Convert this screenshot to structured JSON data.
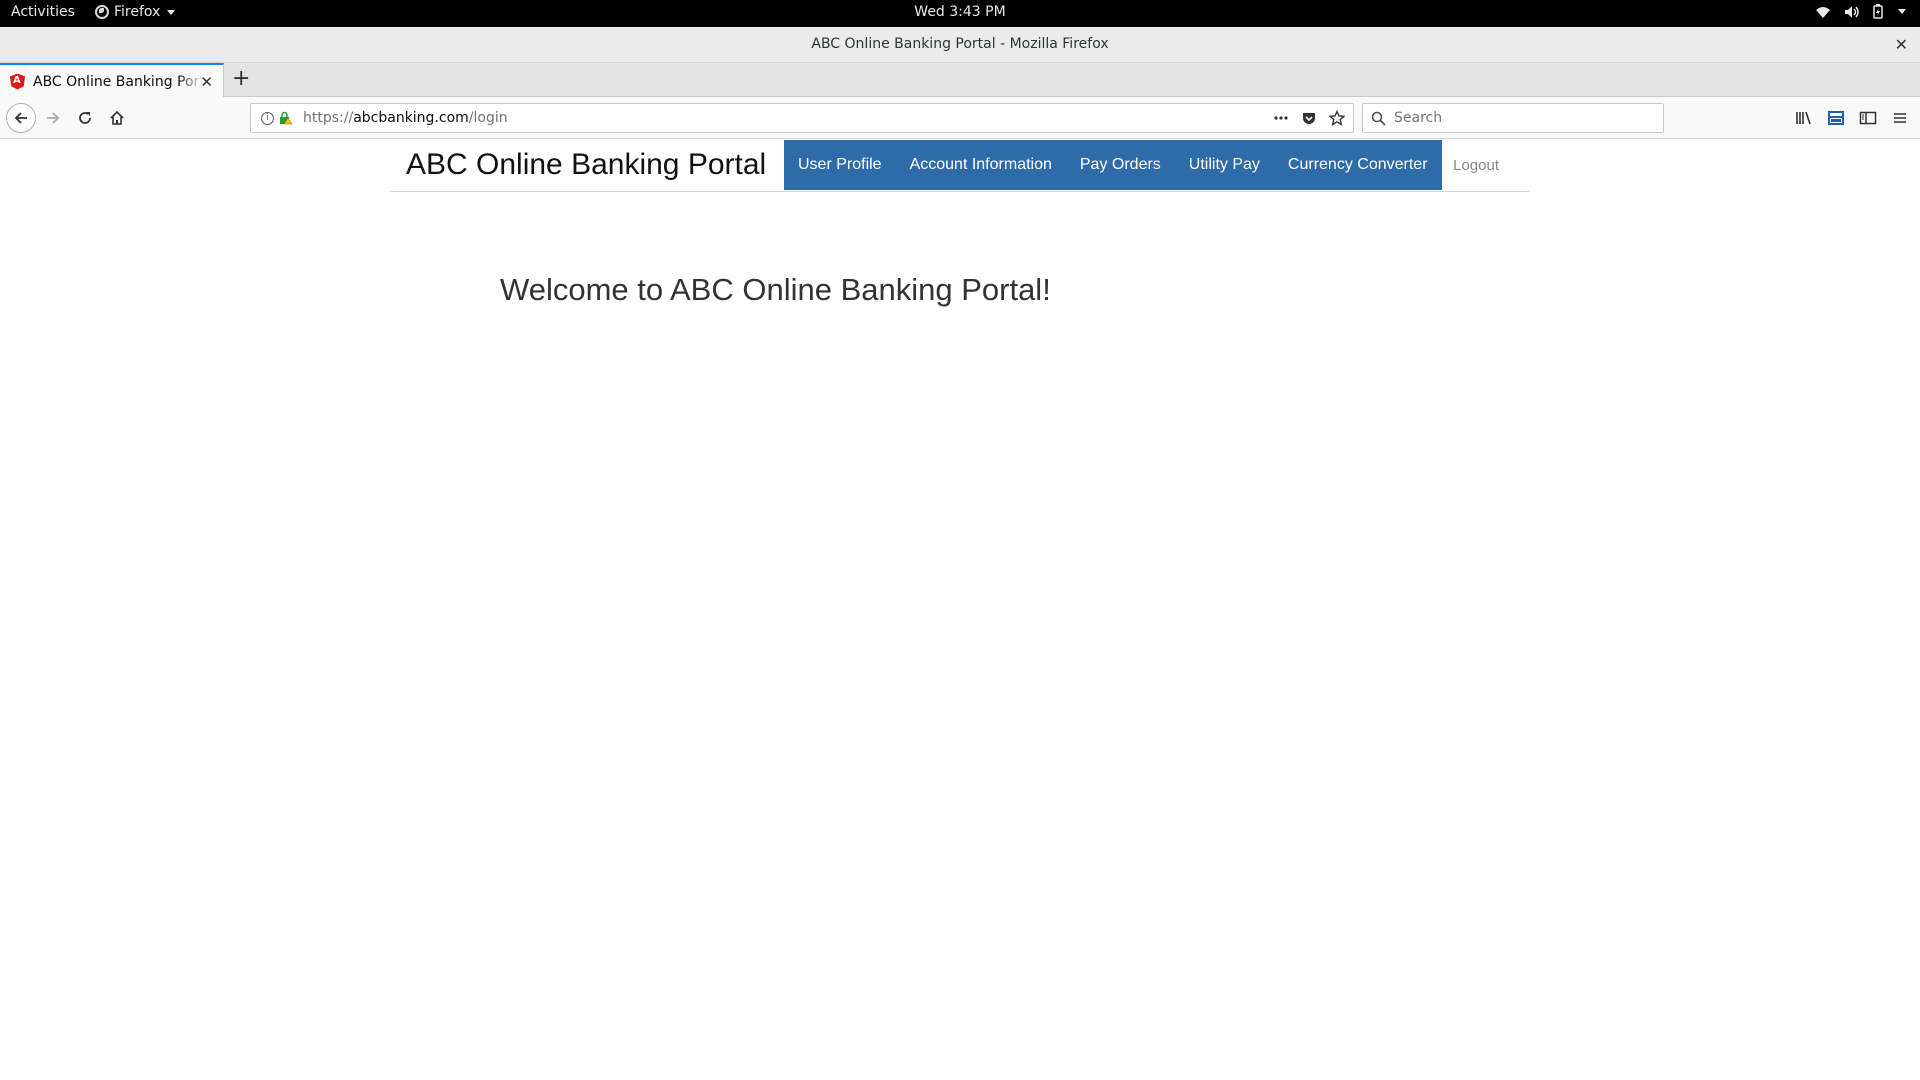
{
  "system": {
    "activities": "Activities",
    "app_name": "Firefox",
    "clock": "Wed  3:43 PM"
  },
  "window": {
    "title": "ABC Online Banking Portal - Mozilla Firefox",
    "close": "✕"
  },
  "tabs": [
    {
      "label": "ABC Online Banking Portal",
      "close": "✕"
    }
  ],
  "newtab": "+",
  "url": {
    "scheme": "https://",
    "host": "abcbanking.com",
    "path": "/login"
  },
  "search": {
    "placeholder": "Search"
  },
  "site": {
    "brand": "ABC Online Banking Portal",
    "menu": [
      "User Profile",
      "Account Information",
      "Pay Orders",
      "Utility Pay",
      "Currency Converter"
    ],
    "logout": "Logout",
    "welcome": "Welcome to ABC Online Banking Portal!"
  },
  "colors": {
    "nav_accent": "#2f6ba8",
    "tab_accent": "#0a84ff"
  }
}
